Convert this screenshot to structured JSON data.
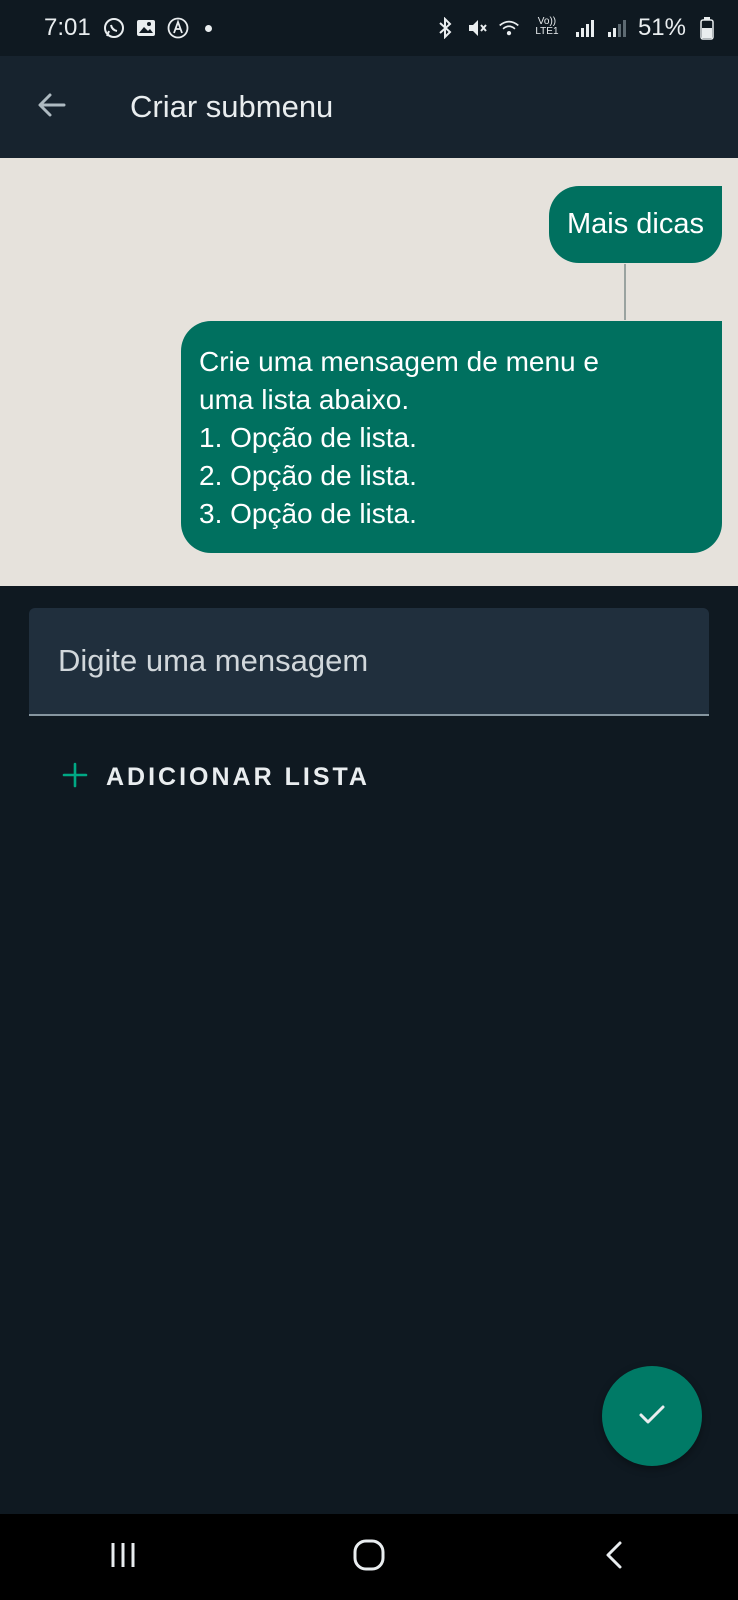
{
  "status_bar": {
    "time": "7:01",
    "battery": "51%",
    "left_icons": [
      "whatsapp-icon",
      "gallery-icon",
      "a-circle-icon",
      "notification-dot"
    ],
    "right_icons": [
      "bluetooth-icon",
      "mute-icon",
      "wifi-icon",
      "volte-icon",
      "signal-icon",
      "signal-icon-2",
      "battery-icon"
    ],
    "volte_label": "Vo)) LTE1"
  },
  "header": {
    "title": "Criar submenu",
    "back_icon": "arrow-back-icon"
  },
  "preview": {
    "trigger_bubble": "Mais dicas",
    "menu_bubble_lines": [
      "Crie uma mensagem de menu e",
      "uma lista abaixo.",
      "1. Opção de lista.",
      "2. Opção de lista.",
      "3. Opção de lista."
    ]
  },
  "composer": {
    "placeholder": "Digite uma mensagem",
    "value": ""
  },
  "add_list": {
    "label": "ADICIONAR LISTA",
    "icon": "plus-icon"
  },
  "fab": {
    "icon": "check-icon"
  },
  "colors": {
    "background": "#0f1921",
    "appbar": "#17232e",
    "preview_bg": "#e6e2dc",
    "bubble": "#00705f",
    "accent": "#00a884",
    "fab": "#007a66"
  }
}
